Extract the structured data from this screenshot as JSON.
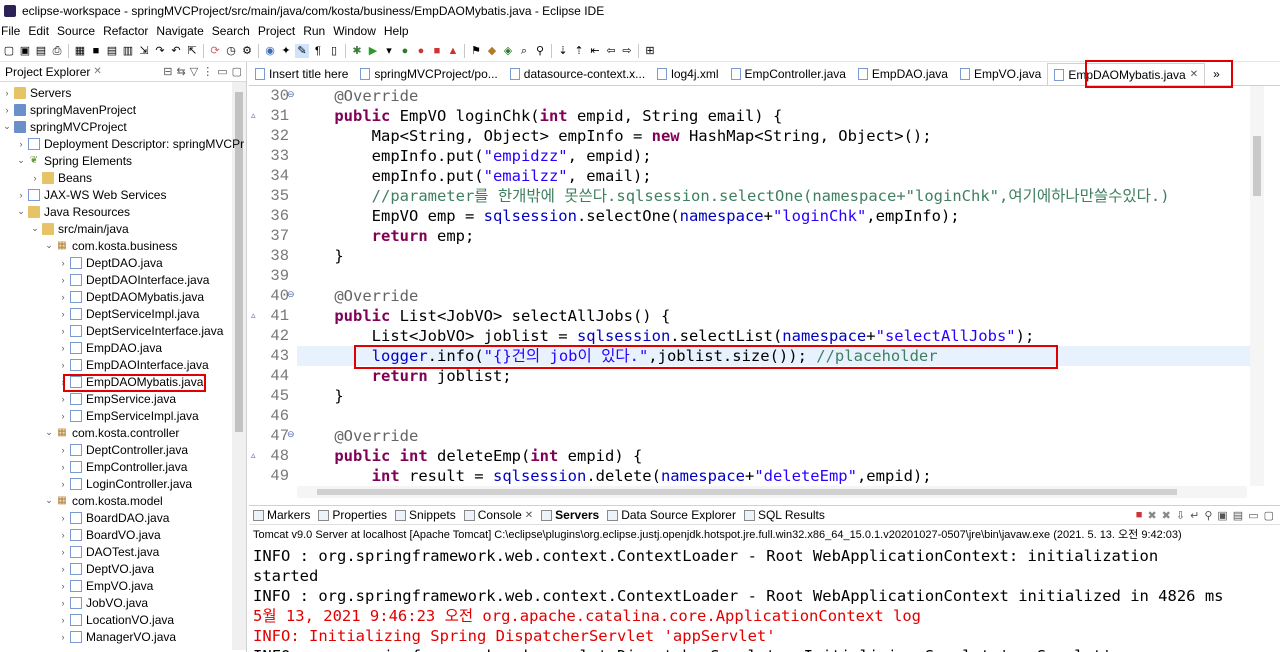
{
  "window": {
    "title": "eclipse-workspace - springMVCProject/src/main/java/com/kosta/business/EmpDAOMybatis.java - Eclipse IDE"
  },
  "menu": [
    "File",
    "Edit",
    "Source",
    "Refactor",
    "Navigate",
    "Search",
    "Project",
    "Run",
    "Window",
    "Help"
  ],
  "explorer": {
    "tab_label": "Project Explorer",
    "items": [
      {
        "label": "Servers",
        "level": 0,
        "expanded": false,
        "icon": "folder-icon"
      },
      {
        "label": "springMavenProject",
        "level": 0,
        "expanded": false,
        "icon": "project-icon"
      },
      {
        "label": "springMVCProject",
        "level": 0,
        "expanded": true,
        "icon": "project-icon"
      },
      {
        "label": "Deployment Descriptor: springMVCPr",
        "level": 1,
        "expanded": false,
        "icon": "file-icon"
      },
      {
        "label": "Spring Elements",
        "level": 1,
        "expanded": true,
        "icon": "leaf-icon"
      },
      {
        "label": "Beans",
        "level": 2,
        "expanded": false,
        "icon": "folder-icon"
      },
      {
        "label": "JAX-WS Web Services",
        "level": 1,
        "expanded": false,
        "icon": "file-icon"
      },
      {
        "label": "Java Resources",
        "level": 1,
        "expanded": true,
        "icon": "folder-icon"
      },
      {
        "label": "src/main/java",
        "level": 2,
        "expanded": true,
        "icon": "folder-icon"
      },
      {
        "label": "com.kosta.business",
        "level": 3,
        "expanded": true,
        "icon": "package-icon"
      },
      {
        "label": "DeptDAO.java",
        "level": 4,
        "expanded": false,
        "icon": "file-icon"
      },
      {
        "label": "DeptDAOInterface.java",
        "level": 4,
        "expanded": false,
        "icon": "file-icon"
      },
      {
        "label": "DeptDAOMybatis.java",
        "level": 4,
        "expanded": false,
        "icon": "file-icon"
      },
      {
        "label": "DeptServiceImpl.java",
        "level": 4,
        "expanded": false,
        "icon": "file-icon"
      },
      {
        "label": "DeptServiceInterface.java",
        "level": 4,
        "expanded": false,
        "icon": "file-icon"
      },
      {
        "label": "EmpDAO.java",
        "level": 4,
        "expanded": false,
        "icon": "file-icon"
      },
      {
        "label": "EmpDAOInterface.java",
        "level": 4,
        "expanded": false,
        "icon": "file-icon"
      },
      {
        "label": "EmpDAOMybatis.java",
        "level": 4,
        "expanded": false,
        "icon": "file-icon",
        "highlighted": true
      },
      {
        "label": "EmpService.java",
        "level": 4,
        "expanded": false,
        "icon": "file-icon"
      },
      {
        "label": "EmpServiceImpl.java",
        "level": 4,
        "expanded": false,
        "icon": "file-icon"
      },
      {
        "label": "com.kosta.controller",
        "level": 3,
        "expanded": true,
        "icon": "package-icon"
      },
      {
        "label": "DeptController.java",
        "level": 4,
        "expanded": false,
        "icon": "file-icon"
      },
      {
        "label": "EmpController.java",
        "level": 4,
        "expanded": false,
        "icon": "file-icon"
      },
      {
        "label": "LoginController.java",
        "level": 4,
        "expanded": false,
        "icon": "file-icon"
      },
      {
        "label": "com.kosta.model",
        "level": 3,
        "expanded": true,
        "icon": "package-icon"
      },
      {
        "label": "BoardDAO.java",
        "level": 4,
        "expanded": false,
        "icon": "file-icon"
      },
      {
        "label": "BoardVO.java",
        "level": 4,
        "expanded": false,
        "icon": "file-icon"
      },
      {
        "label": "DAOTest.java",
        "level": 4,
        "expanded": false,
        "icon": "file-icon"
      },
      {
        "label": "DeptVO.java",
        "level": 4,
        "expanded": false,
        "icon": "file-icon"
      },
      {
        "label": "EmpVO.java",
        "level": 4,
        "expanded": false,
        "icon": "file-icon"
      },
      {
        "label": "JobVO.java",
        "level": 4,
        "expanded": false,
        "icon": "file-icon"
      },
      {
        "label": "LocationVO.java",
        "level": 4,
        "expanded": false,
        "icon": "file-icon"
      },
      {
        "label": "ManagerVO.java",
        "level": 4,
        "expanded": false,
        "icon": "file-icon"
      }
    ]
  },
  "editor_tabs": [
    {
      "label": "Insert title here",
      "active": false
    },
    {
      "label": "springMVCProject/po...",
      "active": false
    },
    {
      "label": "datasource-context.x...",
      "active": false
    },
    {
      "label": "log4j.xml",
      "active": false
    },
    {
      "label": "EmpController.java",
      "active": false
    },
    {
      "label": "EmpDAO.java",
      "active": false
    },
    {
      "label": "EmpVO.java",
      "active": false
    },
    {
      "label": "EmpDAOMybatis.java",
      "active": true
    }
  ],
  "code_lines": [
    {
      "num": "30",
      "marker": "",
      "fold": "⊖",
      "html": "    <span class=\"ann\">@Override</span>"
    },
    {
      "num": "31",
      "marker": "▵",
      "fold": "",
      "html": "    <span class=\"kw\">public</span> EmpVO loginChk(<span class=\"kw\">int</span> empid, String email) {"
    },
    {
      "num": "32",
      "marker": "",
      "fold": "",
      "html": "        Map&lt;String, Object&gt; empInfo = <span class=\"kw\">new</span> HashMap&lt;String, Object&gt;();"
    },
    {
      "num": "33",
      "marker": "",
      "fold": "",
      "html": "        empInfo.put(<span class=\"str\">\"empidzz\"</span>, empid);"
    },
    {
      "num": "34",
      "marker": "",
      "fold": "",
      "html": "        empInfo.put(<span class=\"str\">\"emailzz\"</span>, email);"
    },
    {
      "num": "35",
      "marker": "",
      "fold": "",
      "html": "        <span class=\"cmt\">//parameter를 한개밖에 못쓴다.sqlsession.selectOne(namespace+\"loginChk\",여기에하나만쓸수있다.)</span>"
    },
    {
      "num": "36",
      "marker": "",
      "fold": "",
      "html": "        EmpVO emp = <span class=\"fld\">sqlsession</span>.selectOne(<span class=\"fld\">namespace</span>+<span class=\"str\">\"loginChk\"</span>,empInfo);"
    },
    {
      "num": "37",
      "marker": "",
      "fold": "",
      "html": "        <span class=\"kw\">return</span> emp;"
    },
    {
      "num": "38",
      "marker": "",
      "fold": "",
      "html": "    }"
    },
    {
      "num": "39",
      "marker": "",
      "fold": "",
      "html": ""
    },
    {
      "num": "40",
      "marker": "",
      "fold": "⊖",
      "html": "    <span class=\"ann\">@Override</span>"
    },
    {
      "num": "41",
      "marker": "▵",
      "fold": "",
      "html": "    <span class=\"kw\">public</span> List&lt;JobVO&gt; selectAllJobs() {"
    },
    {
      "num": "42",
      "marker": "",
      "fold": "",
      "html": "        List&lt;JobVO&gt; joblist = <span class=\"fld\">sqlsession</span>.selectList(<span class=\"fld\">namespace</span>+<span class=\"str\">\"selectAllJobs\"</span>);"
    },
    {
      "num": "43",
      "marker": "",
      "fold": "",
      "current": true,
      "html": "        <span class=\"fld\">logger</span>.info(<span class=\"str\">\"{}건의 job이 있다.\"</span>,joblist.size()); <span class=\"cmt\">//placeholder</span>"
    },
    {
      "num": "44",
      "marker": "",
      "fold": "",
      "html": "        <span class=\"kw\">return</span> joblist;"
    },
    {
      "num": "45",
      "marker": "",
      "fold": "",
      "html": "    }"
    },
    {
      "num": "46",
      "marker": "",
      "fold": "",
      "html": ""
    },
    {
      "num": "47",
      "marker": "",
      "fold": "⊖",
      "html": "    <span class=\"ann\">@Override</span>"
    },
    {
      "num": "48",
      "marker": "▵",
      "fold": "",
      "html": "    <span class=\"kw\">public</span> <span class=\"kw\">int</span> deleteEmp(<span class=\"kw\">int</span> empid) {"
    },
    {
      "num": "49",
      "marker": "",
      "fold": "",
      "html": "        <span class=\"kw\">int</span> result = <span class=\"fld\">sqlsession</span>.delete(<span class=\"fld\">namespace</span>+<span class=\"str\">\"deleteEmp\"</span>,empid);"
    }
  ],
  "bottom_tabs": [
    {
      "label": "Markers",
      "active": false
    },
    {
      "label": "Properties",
      "active": false
    },
    {
      "label": "Snippets",
      "active": false
    },
    {
      "label": "Console",
      "active": false,
      "closable": true
    },
    {
      "label": "Servers",
      "active": true
    },
    {
      "label": "Data Source Explorer",
      "active": false
    },
    {
      "label": "SQL Results",
      "active": false
    }
  ],
  "server_status": "Tomcat v9.0 Server at localhost [Apache Tomcat] C:\\eclipse\\plugins\\org.eclipse.justj.openjdk.hotspot.jre.full.win32.x86_64_15.0.1.v20201027-0507\\jre\\bin\\javaw.exe  (2021. 5. 13. 오전 9:42:03)",
  "console_lines": [
    {
      "text": "INFO : org.springframework.web.context.ContextLoader - Root WebApplicationContext: initialization",
      "red": false
    },
    {
      "text": "started",
      "red": false
    },
    {
      "text": "INFO : org.springframework.web.context.ContextLoader - Root WebApplicationContext initialized in 4826 ms",
      "red": false
    },
    {
      "text": "5월 13, 2021 9:46:23 오전 org.apache.catalina.core.ApplicationContext log",
      "red": true
    },
    {
      "text": "INFO: Initializing Spring DispatcherServlet 'appServlet'",
      "red": true
    },
    {
      "text": "INFO : org.springframework.web.servlet.DispatcherServlet - Initializing Servlet 'appServlet'",
      "red": false
    }
  ],
  "colors": {
    "highlight_box": "#e00000",
    "keyword": "#7f0055",
    "string": "#2a00ff",
    "comment": "#3f7f5f",
    "field": "#0000c0"
  }
}
